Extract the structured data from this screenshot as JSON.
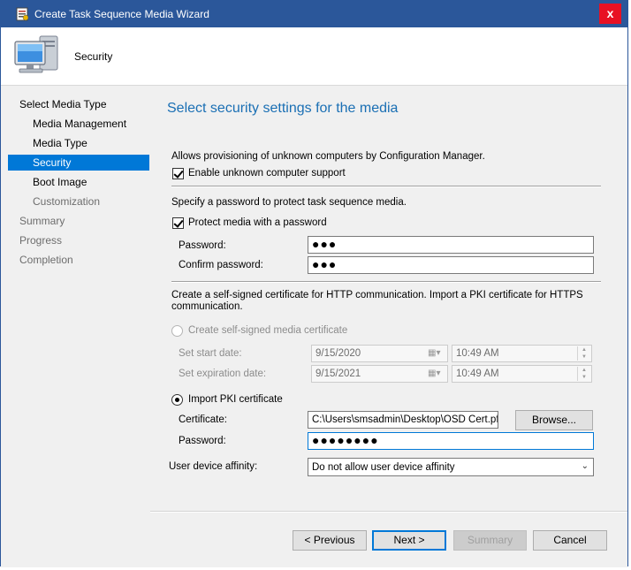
{
  "window": {
    "title": "Create Task Sequence Media Wizard",
    "close_glyph": "x"
  },
  "banner": {
    "title": "Security",
    "icon": "computer-monitor-icon"
  },
  "nav": {
    "items": [
      {
        "label": "Select Media Type",
        "level": "top",
        "state": "normal"
      },
      {
        "label": "Media Management",
        "level": "indent",
        "state": "normal"
      },
      {
        "label": "Media Type",
        "level": "indent",
        "state": "normal"
      },
      {
        "label": "Security",
        "level": "indent",
        "state": "selected"
      },
      {
        "label": "Boot Image",
        "level": "indent",
        "state": "normal"
      },
      {
        "label": "Customization",
        "level": "indent",
        "state": "disabled"
      },
      {
        "label": "Summary",
        "level": "top",
        "state": "disabled"
      },
      {
        "label": "Progress",
        "level": "top",
        "state": "disabled"
      },
      {
        "label": "Completion",
        "level": "top",
        "state": "disabled"
      }
    ]
  },
  "page": {
    "heading": "Select security settings for the media",
    "unknown_desc": "Allows provisioning of unknown computers by Configuration Manager.",
    "unknown_checkbox": "Enable unknown computer support",
    "password_desc": "Specify a password to protect task sequence media.",
    "protect_checkbox": "Protect media with a password",
    "password_label": "Password:",
    "password_value": "●●●",
    "confirm_label": "Confirm password:",
    "confirm_value": "●●●",
    "cert_desc": "Create a self-signed certificate for HTTP communication. Import a PKI certificate for HTTPS communication.",
    "self_signed_radio": "Create self-signed media certificate",
    "start_date_label": "Set start date:",
    "start_date_value": "9/15/2020",
    "start_time_value": "10:49 AM",
    "expiration_label": "Set expiration date:",
    "expiration_date_value": "9/15/2021",
    "expiration_time_value": "10:49 AM",
    "pki_radio": "Import PKI certificate",
    "certificate_label": "Certificate:",
    "certificate_value": "C:\\Users\\smsadmin\\Desktop\\OSD Cert.pfx",
    "browse_button": "Browse...",
    "pki_password_label": "Password:",
    "pki_password_value": "●●●●●●●●",
    "affinity_label": "User device affinity:",
    "affinity_value": "Do not allow user device affinity"
  },
  "footer": {
    "previous": "< Previous",
    "next": "Next >",
    "summary": "Summary",
    "cancel": "Cancel"
  },
  "colors": {
    "titlebar": "#2b579a",
    "selection": "#0078d7",
    "heading": "#1a6fb4",
    "close": "#e81123"
  }
}
